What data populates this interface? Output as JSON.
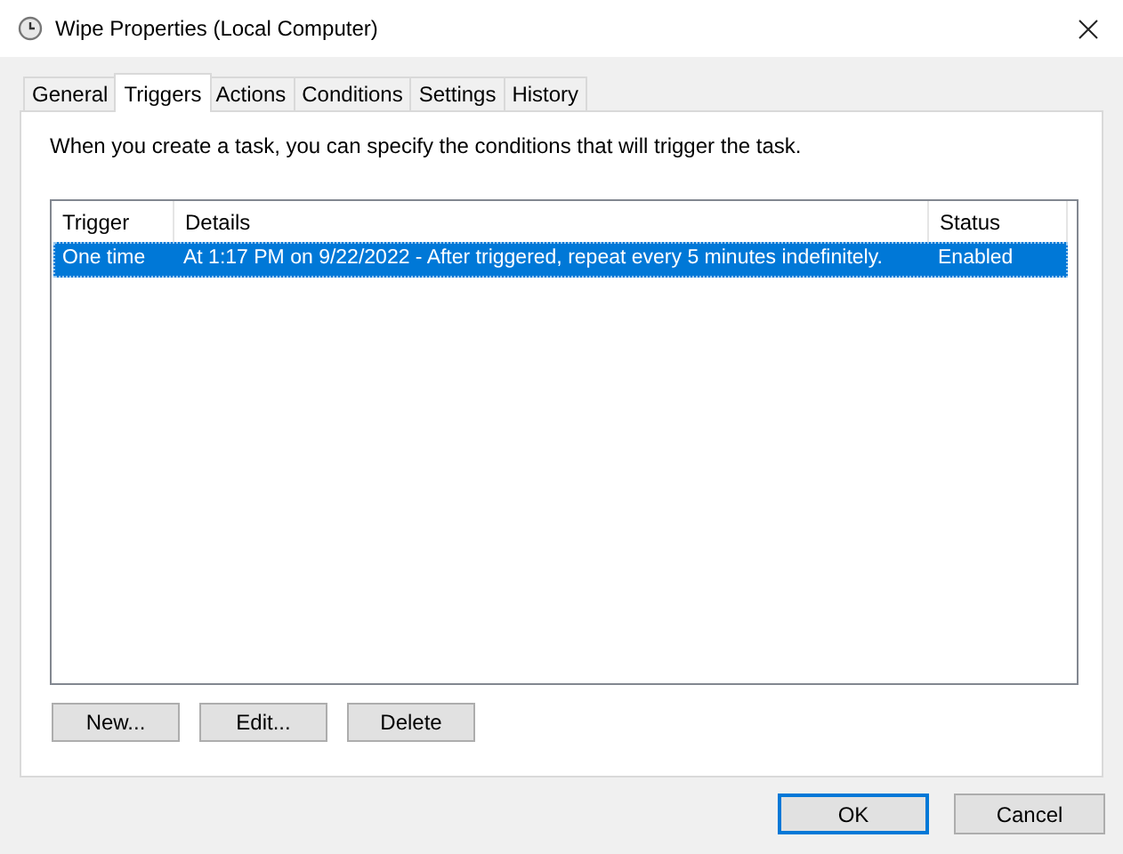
{
  "window": {
    "title": "Wipe Properties (Local Computer)"
  },
  "tabs": [
    {
      "label": "General",
      "selected": false
    },
    {
      "label": "Triggers",
      "selected": true
    },
    {
      "label": "Actions",
      "selected": false
    },
    {
      "label": "Conditions",
      "selected": false
    },
    {
      "label": "Settings",
      "selected": false
    },
    {
      "label": "History",
      "selected": false
    }
  ],
  "description": "When you create a task, you can specify the conditions that will trigger the task.",
  "table": {
    "columns": [
      "Trigger",
      "Details",
      "Status"
    ],
    "rows": [
      {
        "cells": [
          "One time",
          "At 1:17 PM on 9/22/2022 - After triggered, repeat every 5 minutes indefinitely.",
          "Enabled"
        ],
        "selected": true
      }
    ]
  },
  "panel_buttons": [
    "New...",
    "Edit...",
    "Delete"
  ],
  "dialog_buttons": [
    {
      "label": "OK",
      "default": true
    },
    {
      "label": "Cancel",
      "default": false
    }
  ]
}
